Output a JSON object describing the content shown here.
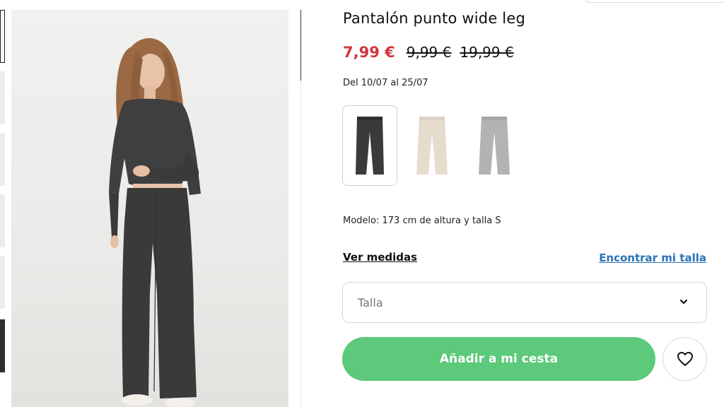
{
  "product": {
    "title": "Pantalón punto wide leg",
    "price_current": "7,99 €",
    "price_old_1": "9,99 €",
    "price_old_2": "19,99 €",
    "delivery_dates": "Del 10/07 al 25/07",
    "model_info": "Modelo: 173 cm de altura y talla S"
  },
  "colors": [
    {
      "name": "dark-grey",
      "hex": "#3a3a3a",
      "selected": true
    },
    {
      "name": "beige",
      "hex": "#e6dccd",
      "selected": false
    },
    {
      "name": "light-grey",
      "hex": "#b3b3b3",
      "selected": false
    }
  ],
  "links": {
    "size_guide": "Ver medidas",
    "find_size": "Encontrar mi talla"
  },
  "size_select": {
    "placeholder": "Talla",
    "icon": "chevron-down-icon"
  },
  "actions": {
    "add_to_cart": "Añadir a mi cesta",
    "favorite_icon": "heart-icon"
  },
  "theme": {
    "accent_green": "#5dc97a",
    "sale_red": "#d1363c",
    "link_blue": "#2a72b5"
  }
}
